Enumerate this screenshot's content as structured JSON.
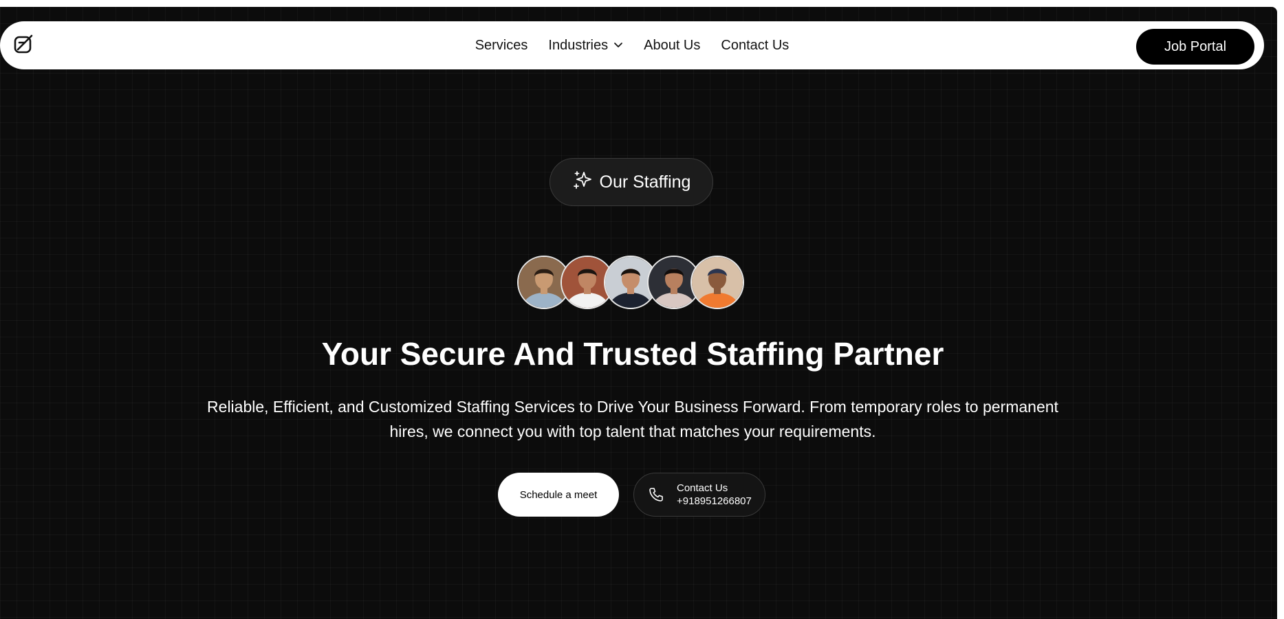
{
  "nav": {
    "logo_icon": "brand-logo-icon",
    "links": [
      {
        "label": "Services"
      },
      {
        "label": "Industries",
        "icon": "chevron-down-icon"
      },
      {
        "label": "About Us"
      },
      {
        "label": "Contact Us"
      }
    ],
    "cta_label": "Job Portal"
  },
  "hero": {
    "badge_icon": "sparkles-icon",
    "badge_label": "Our Staffing",
    "avatars": [
      {
        "name": "avatar-1",
        "bg": "#8a6a4e",
        "skin": "#c99a72",
        "shirt": "#9db3c8",
        "hair": "#2a1d14"
      },
      {
        "name": "avatar-2",
        "bg": "#a0533a",
        "skin": "#c08664",
        "shirt": "#f2f2f2",
        "hair": "#1b1410"
      },
      {
        "name": "avatar-3",
        "bg": "#c9ced4",
        "skin": "#c58d6a",
        "shirt": "#1c2230",
        "hair": "#17110d"
      },
      {
        "name": "avatar-4",
        "bg": "#2d2f36",
        "skin": "#b8805f",
        "shirt": "#d8c7c2",
        "hair": "#120d0b"
      },
      {
        "name": "avatar-5",
        "bg": "#d8c0a8",
        "skin": "#8a5a3c",
        "shirt": "#f07a30",
        "hair": "#2a3550"
      }
    ],
    "title": "Your Secure And Trusted Staffing Partner",
    "description": "Reliable, Efficient, and Customized Staffing Services to Drive Your Business Forward. From temporary roles to permanent hires, we connect you with top talent that matches your requirements.",
    "primary_button": "Schedule a meet",
    "contact_button": {
      "icon": "phone-icon",
      "label": "Contact Us",
      "phone": "+918951266807"
    }
  },
  "colors": {
    "background": "#0c0c0c",
    "navbar": "#ffffff",
    "accent": "#000000",
    "text_light": "#ffffff"
  }
}
